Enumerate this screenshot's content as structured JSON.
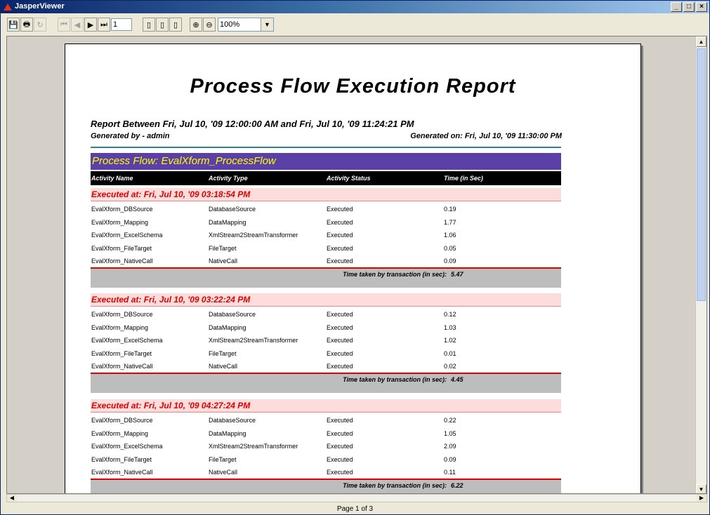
{
  "window": {
    "title": "JasperViewer",
    "minimize": "_",
    "maximize": "□",
    "close": "×"
  },
  "toolbar": {
    "save": "💾",
    "print": "🖶",
    "reload": "↻",
    "first": "⏮",
    "prev": "◀",
    "next": "▶",
    "last": "⏭",
    "page_value": "1",
    "actual_size": "▯",
    "fit_page": "▯",
    "fit_width": "▯",
    "zoom_in": "⊕",
    "zoom_out": "⊖",
    "zoom_value": "100%"
  },
  "status": {
    "page_info": "Page 1 of 3"
  },
  "report": {
    "title": "Process Flow Execution Report",
    "between": "Report Between Fri, Jul 10, '09 12:00:00 AM  and  Fri, Jul 10, '09 11:24:21 PM",
    "generated_by": "Generated by - admin",
    "generated_on": "Generated on: Fri, Jul 10, '09 11:30:00 PM",
    "flow_header": "Process Flow: EvalXform_ProcessFlow",
    "columns": [
      "Activity Name",
      "Activity Type",
      "Activity Status",
      "Time (in Sec)"
    ],
    "total_label": "Time taken by transaction (in sec):",
    "groups": [
      {
        "executed_at": "Executed at:  Fri, Jul 10, '09 03:18:54 PM",
        "rows": [
          [
            "EvalXform_DBSource",
            "DatabaseSource",
            "Executed",
            "0.19"
          ],
          [
            "EvalXform_Mapping",
            "DataMapping",
            "Executed",
            "1.77"
          ],
          [
            "EvalXform_ExcelSchema",
            "XmlStream2StreamTransformer",
            "Executed",
            "1.06"
          ],
          [
            "EvalXform_FileTarget",
            "FileTarget",
            "Executed",
            "0.05"
          ],
          [
            "EvalXform_NativeCall",
            "NativeCall",
            "Executed",
            "0.09"
          ]
        ],
        "total": "5.47"
      },
      {
        "executed_at": "Executed at:  Fri, Jul 10, '09 03:22:24 PM",
        "rows": [
          [
            "EvalXform_DBSource",
            "DatabaseSource",
            "Executed",
            "0.12"
          ],
          [
            "EvalXform_Mapping",
            "DataMapping",
            "Executed",
            "1.03"
          ],
          [
            "EvalXform_ExcelSchema",
            "XmlStream2StreamTransformer",
            "Executed",
            "1.02"
          ],
          [
            "EvalXform_FileTarget",
            "FileTarget",
            "Executed",
            "0.01"
          ],
          [
            "EvalXform_NativeCall",
            "NativeCall",
            "Executed",
            "0.02"
          ]
        ],
        "total": "4.45"
      },
      {
        "executed_at": "Executed at:  Fri, Jul 10, '09 04:27:24 PM",
        "rows": [
          [
            "EvalXform_DBSource",
            "DatabaseSource",
            "Executed",
            "0.22"
          ],
          [
            "EvalXform_Mapping",
            "DataMapping",
            "Executed",
            "1.05"
          ],
          [
            "EvalXform_ExcelSchema",
            "XmlStream2StreamTransformer",
            "Executed",
            "2.09"
          ],
          [
            "EvalXform_FileTarget",
            "FileTarget",
            "Executed",
            "0.09"
          ],
          [
            "EvalXform_NativeCall",
            "NativeCall",
            "Executed",
            "0.11"
          ]
        ],
        "total": "6.22"
      }
    ]
  }
}
